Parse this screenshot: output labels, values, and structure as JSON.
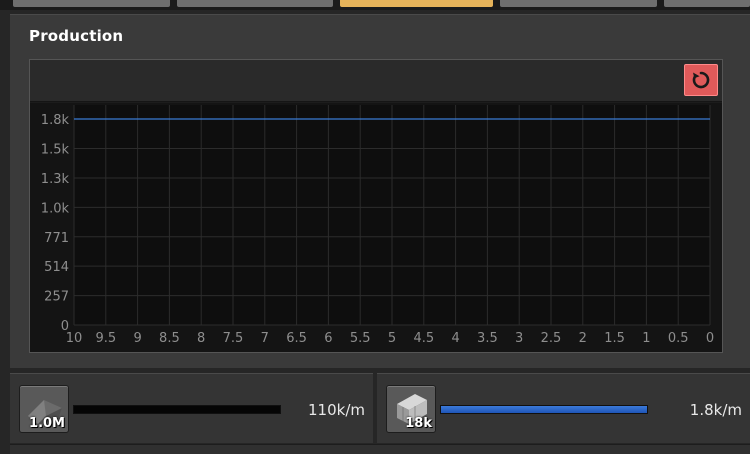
{
  "panel": {
    "title": "Production"
  },
  "toolbar": {
    "reset_icon": "reset-icon"
  },
  "chart_data": {
    "type": "line",
    "x": [
      10,
      9.5,
      9,
      8.5,
      8,
      7.5,
      7,
      6.5,
      6,
      5.5,
      5,
      4.5,
      4,
      3.5,
      3,
      2.5,
      2,
      1.5,
      1,
      0.5,
      0
    ],
    "x_tick_labels": [
      "10",
      "9.5",
      "9",
      "8.5",
      "8",
      "7.5",
      "7",
      "6.5",
      "6",
      "5.5",
      "5",
      "4.5",
      "4",
      "3.5",
      "3",
      "2.5",
      "2",
      "1.5",
      "1",
      "0.5",
      "0"
    ],
    "y_tick_values": [
      0,
      257,
      514,
      771,
      1028,
      1285,
      1542,
      1800
    ],
    "y_tick_labels": [
      "0",
      "257",
      "514",
      "771",
      "1.0k",
      "1.3k",
      "1.5k",
      "1.8k"
    ],
    "ylim": [
      0,
      1800
    ],
    "xlim": [
      10,
      0
    ],
    "grid": true,
    "series": [
      {
        "color": "#3a7bd5",
        "values": [
          1800,
          1800,
          1800,
          1800,
          1800,
          1800,
          1800,
          1800,
          1800,
          1800,
          1800,
          1800,
          1800,
          1800,
          1800,
          1800,
          1800,
          1800,
          1800,
          1800,
          1800
        ]
      }
    ]
  },
  "items": [
    {
      "icon": "stone-icon",
      "count": "1.0M",
      "rate": "110k/m",
      "bar_fraction": 0.0,
      "bar_color": "#2a62c8"
    },
    {
      "icon": "stone-brick-icon",
      "count": "18k",
      "rate": "1.8k/m",
      "bar_fraction": 1.0,
      "bar_color": "#2a62c8"
    }
  ]
}
